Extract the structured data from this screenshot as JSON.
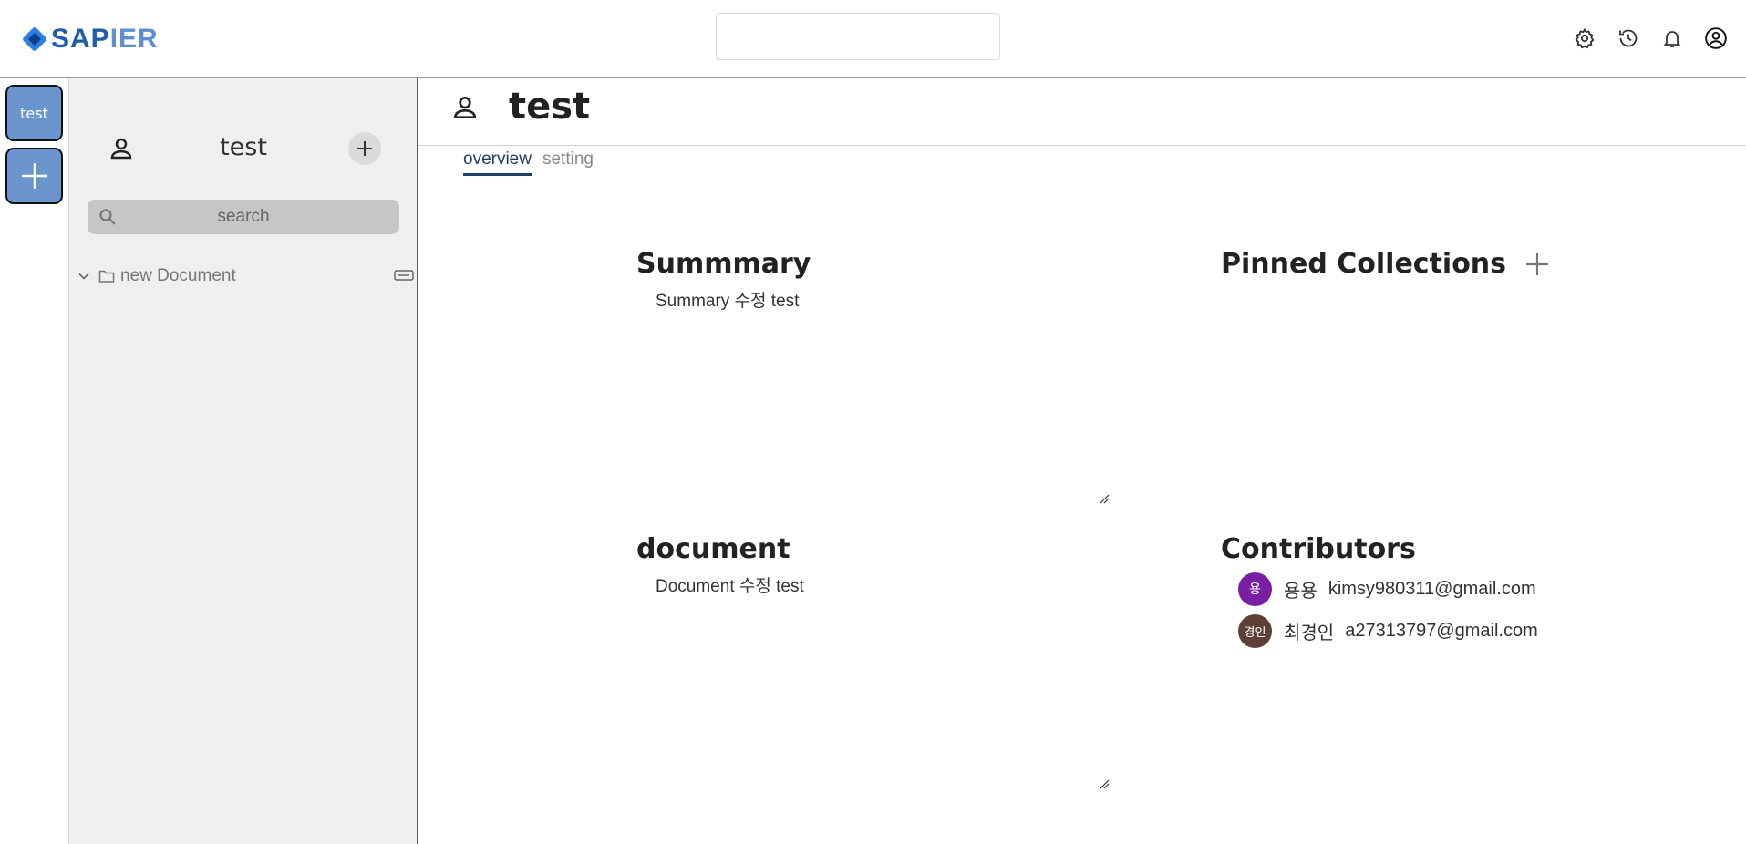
{
  "header": {
    "logo_text_a": "SAP",
    "logo_text_b": "IER",
    "icons": [
      "gear-icon",
      "history-icon",
      "bell-icon",
      "account-icon"
    ]
  },
  "rail": {
    "workspace_label": "test",
    "add_icon": "plus-icon"
  },
  "sidebar": {
    "title": "test",
    "search_placeholder": "search",
    "tree": [
      {
        "label": "new Document",
        "icon": "folder-icon"
      }
    ]
  },
  "main": {
    "title": "test",
    "tabs": [
      {
        "label": "overview",
        "active": true
      },
      {
        "label": "setting",
        "active": false
      }
    ],
    "summary": {
      "title": "Summmary",
      "body": "Summary 수정 test"
    },
    "document": {
      "title": "document",
      "body": "Document 수정 test"
    },
    "pinned": {
      "title": "Pinned Collections"
    },
    "contributors": {
      "title": "Contributors",
      "people": [
        {
          "initial": "용",
          "name": "용용",
          "email": "kimsy980311@gmail.com",
          "color": "#7b1fa2"
        },
        {
          "initial": "경인",
          "name": "최경인",
          "email": "a27313797@gmail.com",
          "color": "#5d4037"
        }
      ]
    }
  },
  "colors": {
    "accent": "#1d3f66",
    "workspace_button": "#6b95cf",
    "sidebar_bg": "#efefef"
  }
}
